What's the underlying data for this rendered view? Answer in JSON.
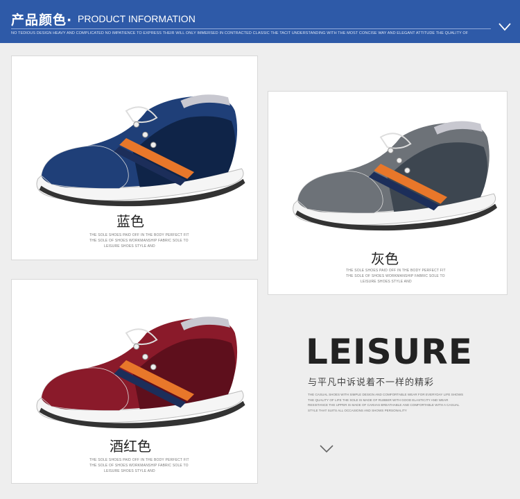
{
  "header": {
    "title_cn": "产品颜色·",
    "title_en": "PRODUCT INFORMATION",
    "subtitle": "NO TEDIOUS DESIGN HEAVY AND COMPLICATED NO IMPATIENCE TO EXPRESS THEIR WILL ONLY IMMERSED IN CONTRACTED CLASSIC THE TACIT UNDERSTANDING WITH THE MOST CONCISE WAY AND ELEGANT ATTITUDE THE QUALITY OF"
  },
  "cards": [
    {
      "label": "蓝色",
      "fine1": "THE SOLE SHOES PAID OFF IN THE BODY PERFECT FIT",
      "fine2": "THE SOLE OF SHOES WORKMANSHIP FABRIC SOLE TO",
      "fine3": "LEISURE SHOES STYLE AND",
      "colors": {
        "main": "#1f3f78",
        "dark": "#0f2448",
        "accent": "#e8772a"
      }
    },
    {
      "label": "灰色",
      "fine1": "THE SOLE SHOES PAID OFF IN THE BODY PERFECT FIT",
      "fine2": "THE SOLE OF SHOES WORKMANSHIP FABRIC SOLE TO",
      "fine3": "LEISURE SHOES STYLE AND",
      "colors": {
        "main": "#6d7278",
        "dark": "#3d4650",
        "accent": "#e8772a"
      }
    },
    {
      "label": "酒红色",
      "fine1": "THE SOLE SHOES PAID OFF IN THE BODY PERFECT FIT",
      "fine2": "THE SOLE OF SHOES WORKMANSHIP FABRIC SOLE TO",
      "fine3": "LEISURE SHOES STYLE AND",
      "colors": {
        "main": "#8a1a2a",
        "dark": "#5e0f1c",
        "accent": "#e8772a"
      }
    }
  ],
  "promo": {
    "headline": "LEISURE",
    "slogan": "与平凡中诉说着不一样的精彩",
    "para": "THE CASUAL SHOES WITH SIMPLE DESIGN AND COMFORTABLE WEAR FOR EVERYDAY LIFE SHOWS THE QUALITY OF LIFE THE SOLE IS MADE OF RUBBER WITH GOOD ELASTICITY AND WEAR RESISTANCE THE UPPER IS MADE OF CANVAS BREATHABLE AND COMFORTABLE WITH A CASUAL STYLE THAT SUITS ALL OCCASIONS AND SHOWS PERSONALITY"
  }
}
